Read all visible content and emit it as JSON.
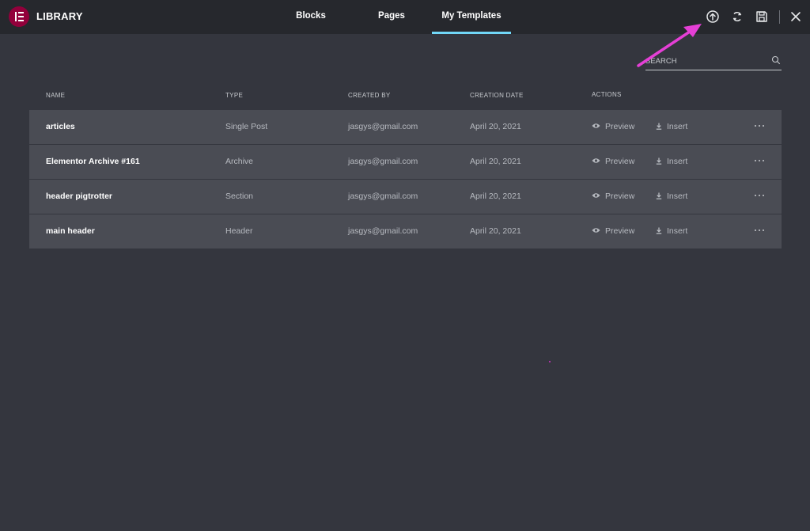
{
  "header": {
    "brand": "LIBRARY",
    "tabs": [
      {
        "label": "Blocks",
        "active": false
      },
      {
        "label": "Pages",
        "active": false
      },
      {
        "label": "My Templates",
        "active": true
      }
    ],
    "tools": [
      "upload-icon",
      "sync-icon",
      "save-icon",
      "close-icon"
    ]
  },
  "search": {
    "placeholder": "SEARCH",
    "value": ""
  },
  "table": {
    "columns": [
      "NAME",
      "TYPE",
      "CREATED BY",
      "CREATION DATE",
      "ACTIONS"
    ],
    "rows": [
      {
        "name": "articles",
        "type": "Single Post",
        "created_by": "jasgys@gmail.com",
        "date": "April 20, 2021",
        "preview": "Preview",
        "insert": "Insert"
      },
      {
        "name": "Elementor Archive #161",
        "type": "Archive",
        "created_by": "jasgys@gmail.com",
        "date": "April 20, 2021",
        "preview": "Preview",
        "insert": "Insert"
      },
      {
        "name": "header pigtrotter",
        "type": "Section",
        "created_by": "jasgys@gmail.com",
        "date": "April 20, 2021",
        "preview": "Preview",
        "insert": "Insert"
      },
      {
        "name": "main header",
        "type": "Header",
        "created_by": "jasgys@gmail.com",
        "date": "April 20, 2021",
        "preview": "Preview",
        "insert": "Insert"
      }
    ]
  },
  "colors": {
    "background": "#34363e",
    "topbar": "#26282d",
    "row": "#4a4c54",
    "brand_logo": "#92003b",
    "active_tab_underline": "#71d7f7",
    "annotation_arrow": "#e53fd6"
  }
}
